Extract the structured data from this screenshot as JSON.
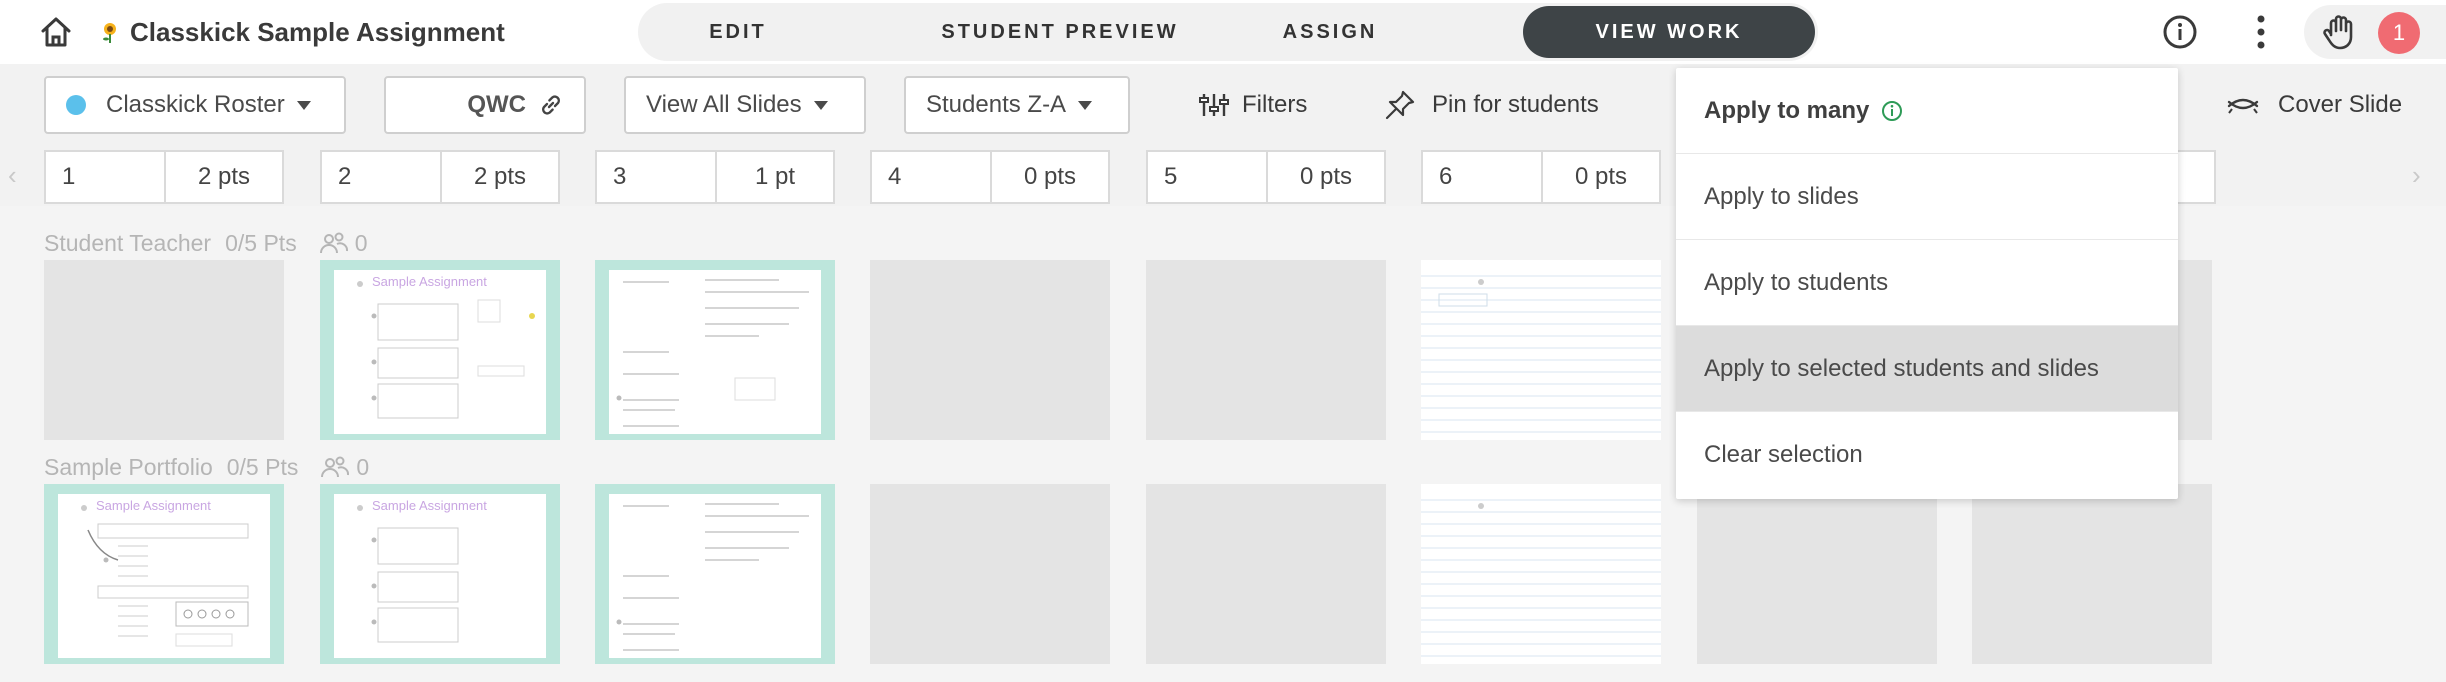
{
  "header": {
    "title": "Classkick Sample Assignment",
    "tabs": [
      {
        "label": "EDIT"
      },
      {
        "label": "STUDENT PREVIEW"
      },
      {
        "label": "ASSIGN"
      },
      {
        "label": "VIEW WORK",
        "active": true
      }
    ],
    "notification_count": "1",
    "icons": [
      "home-icon",
      "sunflower-logo-icon",
      "info-icon",
      "more-vertical-icon",
      "raised-hand-icon"
    ]
  },
  "toolbar": {
    "roster": {
      "label": "Classkick Roster",
      "dot_color": "#5bc0eb"
    },
    "class_code": "QWC",
    "slides_filter": "View All Slides",
    "sort": "Students Z-A",
    "filters_label": "Filters",
    "pin_label": "Pin for students",
    "cover_slide_label": "Cover Slide"
  },
  "slides": [
    {
      "num": "1",
      "pts": "2 pts"
    },
    {
      "num": "2",
      "pts": "2 pts"
    },
    {
      "num": "3",
      "pts": "1 pt"
    },
    {
      "num": "4",
      "pts": "0 pts"
    },
    {
      "num": "5",
      "pts": "0 pts"
    },
    {
      "num": "6",
      "pts": "0 pts"
    }
  ],
  "students": [
    {
      "name": "Student Teacher",
      "points": "0/5 Pts",
      "group_count": "0"
    },
    {
      "name": "Sample Portfolio",
      "points": "0/5 Pts",
      "group_count": "0"
    }
  ],
  "thumbnail_text": {
    "sample_title": "Sample Assignment"
  },
  "apply_menu": {
    "title": "Apply to many",
    "items": [
      {
        "label": "Apply to slides"
      },
      {
        "label": "Apply to students"
      },
      {
        "label": "Apply to selected students and slides",
        "selected": true
      },
      {
        "label": "Clear selection"
      }
    ]
  },
  "colors": {
    "active_tab": "#3e4447",
    "badge": "#f06b72",
    "thumb_border": "#bde6dc",
    "info_green": "#2e9b57"
  }
}
